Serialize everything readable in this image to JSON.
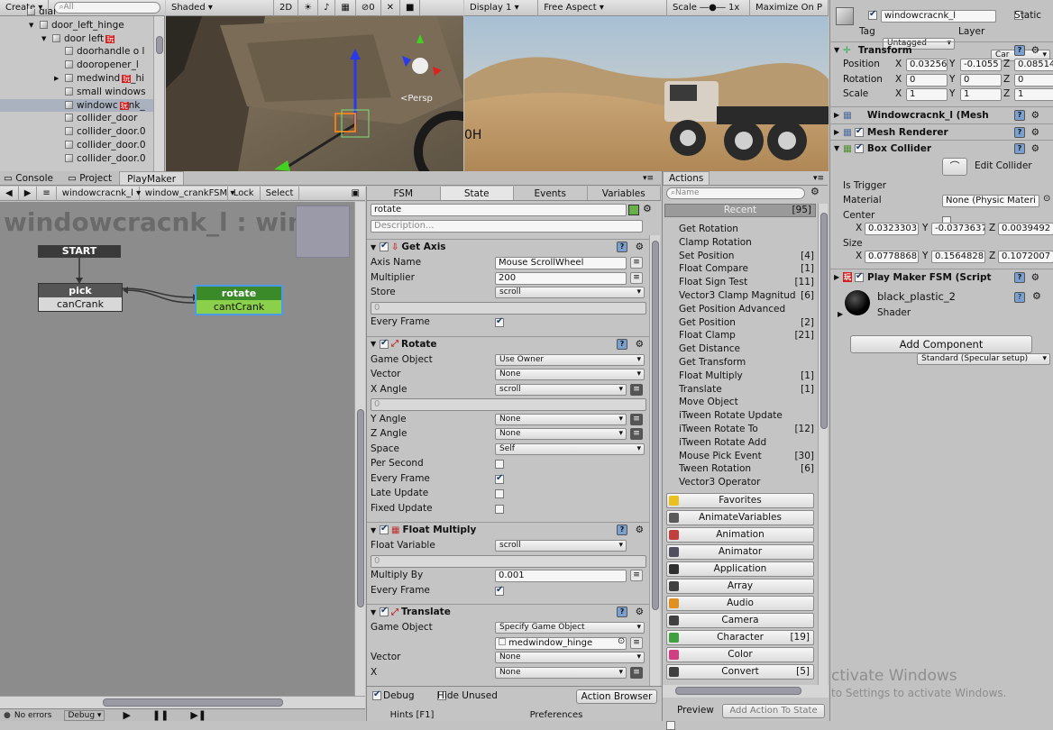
{
  "hierarchy": {
    "create": "Create",
    "search": "All",
    "items": [
      {
        "label": "dial",
        "indent": 0
      },
      {
        "label": "door_left_hinge",
        "indent": 1,
        "arrow": "▼"
      },
      {
        "label": "door left",
        "indent": 2,
        "arrow": "▼",
        "badge": "玩"
      },
      {
        "label": "doorhandle o l",
        "indent": 3
      },
      {
        "label": "dooropener_l",
        "indent": 3
      },
      {
        "label": "medwind",
        "indent": 3,
        "arrow": "▶",
        "badge": "玩",
        "suffix": "_hi"
      },
      {
        "label": "small windows",
        "indent": 3
      },
      {
        "label": "windowc",
        "indent": 3,
        "badge": "玩",
        "suffix": "nk_",
        "selected": true
      },
      {
        "label": "collider_door",
        "indent": 3
      },
      {
        "label": "collider_door.0",
        "indent": 3
      },
      {
        "label": "collider_door.0",
        "indent": 3
      },
      {
        "label": "collider_door.0",
        "indent": 3
      }
    ]
  },
  "scene": {
    "shading": "Shaded",
    "mode2d": "2D",
    "gizmo_count": "0",
    "persp": "<Persp",
    "h_label": "0H"
  },
  "game": {
    "display": "Display 1",
    "aspect": "Free Aspect",
    "scale_label": "Scale",
    "scale_value": "1x",
    "maximize": "Maximize On P"
  },
  "inspector": {
    "object_name": "windowcracnk_l",
    "static_label": "Static",
    "tag_label": "Tag",
    "tag_value": "Untagged",
    "layer_label": "Layer",
    "layer_value": "Car",
    "transform": {
      "title": "Transform",
      "rows": [
        {
          "label": "Position",
          "x": "0.03256",
          "y": "-0.1055",
          "z": "0.08514"
        },
        {
          "label": "Rotation",
          "x": "0",
          "y": "0",
          "z": "0"
        },
        {
          "label": "Scale",
          "x": "1",
          "y": "1",
          "z": "1"
        }
      ]
    },
    "components": [
      "Windowcracnk_l (Mesh",
      "Mesh Renderer",
      "Box Collider"
    ],
    "box_collider": {
      "edit_label": "Edit Collider",
      "is_trigger": "Is Trigger",
      "material_label": "Material",
      "material_value": "None (Physic Materi",
      "center_label": "Center",
      "center": {
        "x": "0.0323303",
        "y": "-0.0373637",
        "z": "0.0039492"
      },
      "size_label": "Size",
      "size": {
        "x": "0.0778868",
        "y": "0.1564828",
        "z": "0.1072007"
      }
    },
    "fsm_component": "Play Maker FSM (Script",
    "material_name": "black_plastic_2",
    "shader_label": "Shader",
    "shader_value": "Standard (Specular setup)",
    "add_component": "Add Component"
  },
  "bottom_tabs": [
    "Console",
    "Project",
    "PlayMaker"
  ],
  "playmaker": {
    "object": "windowcracnk_l",
    "fsm": "window_crankFSM",
    "lock": "Lock",
    "select": "Select",
    "title": "windowcracnk_l : windo",
    "states": {
      "start": "START",
      "pick": "pick",
      "pick_event": "canCrank",
      "rotate": "rotate",
      "rotate_event": "cantCrank"
    }
  },
  "state_editor": {
    "tabs": [
      "FSM",
      "State",
      "Events",
      "Variables"
    ],
    "state_name": "rotate",
    "description": "Description...",
    "actions": [
      {
        "title": "Get Axis",
        "rows": [
          {
            "label": "Axis Name",
            "type": "field",
            "value": "Mouse ScrollWheel"
          },
          {
            "label": "Multiplier",
            "type": "field",
            "value": "200"
          },
          {
            "label": "Store",
            "type": "drop",
            "value": "scroll"
          },
          {
            "label": "",
            "type": "blank",
            "value": "0"
          },
          {
            "label": "Every Frame",
            "type": "check",
            "value": "on"
          }
        ]
      },
      {
        "title": "Rotate",
        "rows": [
          {
            "label": "Game Object",
            "type": "drop",
            "value": "Use Owner"
          },
          {
            "label": "Vector",
            "type": "drop",
            "value": "None"
          },
          {
            "label": "X Angle",
            "type": "drop",
            "value": "scroll"
          },
          {
            "label": "",
            "type": "blank",
            "value": "0"
          },
          {
            "label": "Y Angle",
            "type": "drop",
            "value": "None"
          },
          {
            "label": "Z Angle",
            "type": "drop",
            "value": "None"
          },
          {
            "label": "Space",
            "type": "drop",
            "value": "Self"
          },
          {
            "label": "Per Second",
            "type": "check",
            "value": "off"
          },
          {
            "label": "Every Frame",
            "type": "check",
            "value": "on"
          },
          {
            "label": "Late Update",
            "type": "check",
            "value": "off"
          },
          {
            "label": "Fixed Update",
            "type": "check",
            "value": "off"
          }
        ]
      },
      {
        "title": "Float Multiply",
        "rows": [
          {
            "label": "Float Variable",
            "type": "drop",
            "value": "scroll"
          },
          {
            "label": "",
            "type": "blank",
            "value": "0"
          },
          {
            "label": "Multiply By",
            "type": "field",
            "value": "0.001"
          },
          {
            "label": "Every Frame",
            "type": "check",
            "value": "on"
          }
        ]
      },
      {
        "title": "Translate",
        "rows": [
          {
            "label": "Game Object",
            "type": "drop",
            "value": "Specify Game Object"
          },
          {
            "label": "",
            "type": "obj",
            "value": "medwindow_hinge"
          },
          {
            "label": "Vector",
            "type": "drop",
            "value": "None"
          },
          {
            "label": "X",
            "type": "drop",
            "value": "None"
          }
        ]
      }
    ],
    "debug": "Debug",
    "hide_unused": "Hide Unused",
    "action_browser": "Action Browser",
    "hints": "Hints [F1]",
    "preferences": "Preferences"
  },
  "actions_panel": {
    "tab": "Actions",
    "search": "Name",
    "recent_label": "Recent",
    "recent_count": "[95]",
    "items": [
      {
        "name": "Get Rotation",
        "count": ""
      },
      {
        "name": "Clamp Rotation",
        "count": ""
      },
      {
        "name": "Set Position",
        "count": "[4]"
      },
      {
        "name": "Float Compare",
        "count": "[1]"
      },
      {
        "name": "Float Sign Test",
        "count": "[11]"
      },
      {
        "name": "Vector3 Clamp Magnitud",
        "count": "[6]"
      },
      {
        "name": "Get Position Advanced",
        "count": ""
      },
      {
        "name": "Get Position",
        "count": "[2]"
      },
      {
        "name": "Float Clamp",
        "count": "[21]"
      },
      {
        "name": "Get Distance",
        "count": ""
      },
      {
        "name": "Get Transform",
        "count": ""
      },
      {
        "name": "Float Multiply",
        "count": "[1]"
      },
      {
        "name": "Translate",
        "count": "[1]"
      },
      {
        "name": "Move Object",
        "count": ""
      },
      {
        "name": "iTween Rotate Update",
        "count": ""
      },
      {
        "name": "iTween Rotate To",
        "count": "[12]"
      },
      {
        "name": "iTween Rotate Add",
        "count": ""
      },
      {
        "name": "Mouse Pick Event",
        "count": "[30]"
      },
      {
        "name": "Tween Rotation",
        "count": "[6]"
      },
      {
        "name": "Vector3 Operator",
        "count": ""
      }
    ],
    "categories": [
      {
        "name": "Favorites",
        "count": "",
        "color": "#e8c020"
      },
      {
        "name": "AnimateVariables",
        "count": "",
        "color": "#5a5a5a"
      },
      {
        "name": "Animation",
        "count": "",
        "color": "#c04040"
      },
      {
        "name": "Animator",
        "count": "",
        "color": "#505060"
      },
      {
        "name": "Application",
        "count": "",
        "color": "#303030"
      },
      {
        "name": "Array",
        "count": "",
        "color": "#404040"
      },
      {
        "name": "Audio",
        "count": "",
        "color": "#e09020"
      },
      {
        "name": "Camera",
        "count": "",
        "color": "#404040"
      },
      {
        "name": "Character",
        "count": "[19]",
        "color": "#40a040"
      },
      {
        "name": "Color",
        "count": "",
        "color": "#d04080"
      },
      {
        "name": "Convert",
        "count": "[5]",
        "color": "#404040"
      }
    ],
    "preview": "Preview",
    "add_action": "Add Action To State"
  },
  "status": {
    "errors": "No errors",
    "debug": "Debug"
  },
  "watermark": {
    "line1": "ctivate Windows",
    "line2": "to Settings to activate Windows."
  }
}
